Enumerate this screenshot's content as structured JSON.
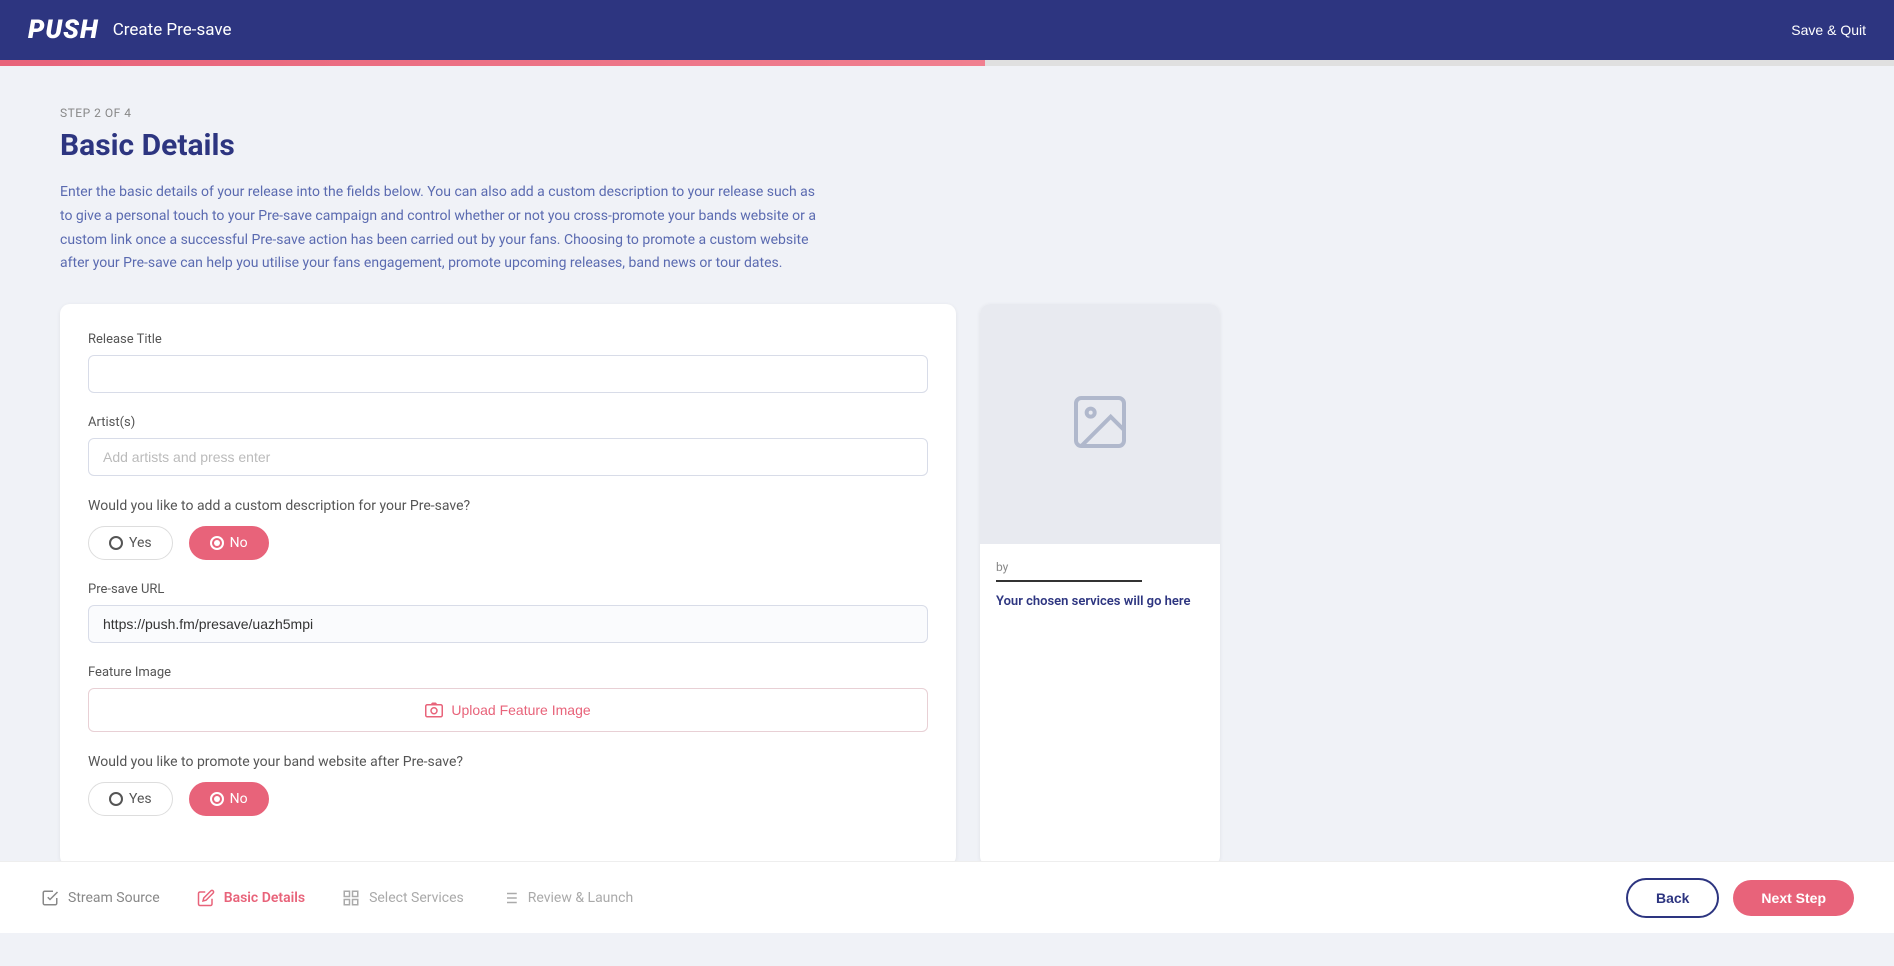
{
  "header": {
    "logo": "PUSH",
    "title": "Create Pre-save",
    "save_quit_label": "Save & Quit"
  },
  "progress": {
    "step_current": 2,
    "step_total": 4,
    "percent": 52
  },
  "step_label": "STEP 2 OF 4",
  "page_title": "Basic Details",
  "description": "Enter the basic details of your release into the fields below. You can also add a custom description to your release such as to give a personal touch to your Pre-save campaign and control whether or not you cross-promote your bands website or a custom link once a successful Pre-save action has been carried out by your fans. Choosing to promote a custom website after your Pre-save can help you utilise your fans engagement, promote upcoming releases, band news or tour dates.",
  "form": {
    "release_title_label": "Release Title",
    "release_title_value": "",
    "release_title_placeholder": "",
    "artists_label": "Artist(s)",
    "artists_placeholder": "Add artists and press enter",
    "custom_desc_question": "Would you like to add a custom description for your Pre-save?",
    "custom_desc_yes": "Yes",
    "custom_desc_no": "No",
    "custom_desc_selected": "No",
    "presave_url_label": "Pre-save URL",
    "presave_url_value": "https://push.fm/presave/uazh5mpi",
    "feature_image_label": "Feature Image",
    "upload_label": "Upload Feature Image",
    "promote_website_question": "Would you like to promote your band website after Pre-save?",
    "promote_yes": "Yes",
    "promote_no": "No",
    "promote_selected": "No"
  },
  "preview": {
    "by_label": "by",
    "services_placeholder": "Your chosen services will go here"
  },
  "footer": {
    "steps": [
      {
        "id": "stream-source",
        "label": "Stream Source",
        "state": "completed",
        "icon": "check-square"
      },
      {
        "id": "basic-details",
        "label": "Basic Details",
        "state": "active",
        "icon": "edit"
      },
      {
        "id": "select-services",
        "label": "Select Services",
        "state": "inactive",
        "icon": "grid"
      },
      {
        "id": "review-launch",
        "label": "Review & Launch",
        "state": "inactive",
        "icon": "list"
      }
    ],
    "back_label": "Back",
    "next_label": "Next Step"
  }
}
